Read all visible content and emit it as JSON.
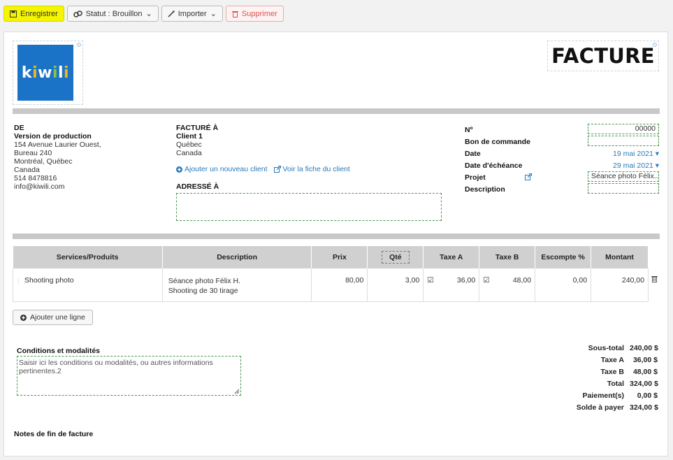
{
  "toolbar": {
    "save": "Enregistrer",
    "status": "Statut : Brouillon",
    "import": "Importer",
    "delete": "Supprimer"
  },
  "doc": {
    "logo_text": "kiwili",
    "title": "FACTURE"
  },
  "from": {
    "label": "DE",
    "name": "Version de production",
    "lines": [
      "154 Avenue Laurier Ouest,",
      "Bureau 240",
      "Montréal, Québec",
      "Canada",
      "514 8478816",
      "info@kiwili.com"
    ]
  },
  "billed_to": {
    "label": "FACTURÉ À",
    "name": "Client 1",
    "lines": [
      "Québec",
      "Canada"
    ],
    "add_client": "Ajouter un nouveau client",
    "view_client": "Voir la fiche du client",
    "addressed_label": "ADRESSÉ À"
  },
  "meta": {
    "number_label": "Nº",
    "number_value": "00000",
    "po_label": "Bon de commande",
    "date_label": "Date",
    "date_value": "19 mai 2021",
    "due_label": "Date d'échéance",
    "due_value": "29 mai 2021",
    "project_label": "Projet",
    "project_value": "Séance photo Félix...",
    "description_label": "Description"
  },
  "table": {
    "headers": [
      "Services/Produits",
      "Description",
      "Prix",
      "Qté",
      "Taxe A",
      "Taxe B",
      "Escompte %",
      "Montant"
    ],
    "rows": [
      {
        "service": "Shooting photo",
        "desc1": "Séance photo Félix H.",
        "desc2": "Shooting de 30 tirage",
        "price": "80,00",
        "qty": "3,00",
        "tax_a": "36,00",
        "tax_b": "48,00",
        "discount": "0,00",
        "amount": "240,00"
      }
    ]
  },
  "add_line": "Ajouter une ligne",
  "conditions": {
    "label": "Conditions et modalités",
    "text": "Saisir ici les conditions ou modalités, ou autres informations pertinentes.2"
  },
  "totals": {
    "subtotal_label": "Sous-total",
    "subtotal": "240,00 $",
    "tax_a_label": "Taxe A",
    "tax_a": "36,00 $",
    "tax_b_label": "Taxe B",
    "tax_b": "48,00 $",
    "total_label": "Total",
    "total": "324,00 $",
    "payments_label": "Paiement(s)",
    "payments": "0,00 $",
    "balance_label": "Solde à payer",
    "balance": "324,00 $"
  },
  "footer_notes_label": "Notes de fin de facture"
}
